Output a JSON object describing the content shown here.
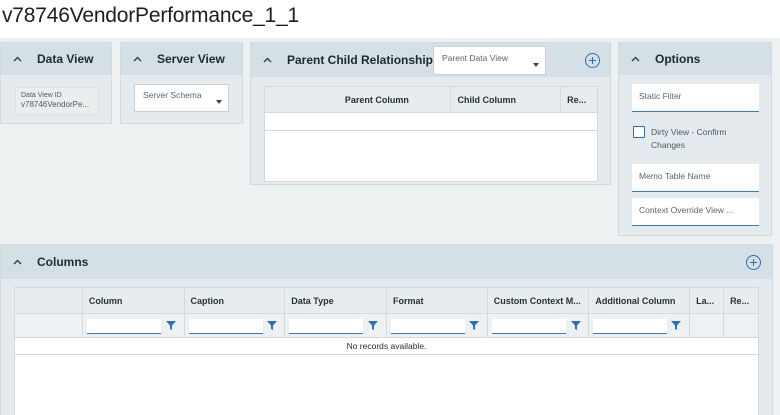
{
  "page": {
    "title": "v78746VendorPerformance_1_1"
  },
  "data_view": {
    "heading": "Data View",
    "field_label": "Data View ID",
    "field_value": "v78746VendorPe..."
  },
  "server_view": {
    "heading": "Server View",
    "schema_placeholder": "Server Schema"
  },
  "relationships": {
    "heading": "Parent Child Relationships",
    "parent_select": "Parent Data View",
    "columns": [
      "",
      "Parent Column",
      "Child Column",
      "Re..."
    ]
  },
  "options": {
    "heading": "Options",
    "static_filter": "Static Filter",
    "dirty_view_label": "Dirty View - Confirm Changes",
    "memo_table": "Memo Table Name",
    "context_override": "Context Override View ..."
  },
  "columns_section": {
    "heading": "Columns",
    "columns": [
      "",
      "Column",
      "Caption",
      "Data Type",
      "Format",
      "Custom Context M...",
      "Additional Column",
      "La...",
      "Re..."
    ],
    "empty_text": "No records available."
  },
  "colors": {
    "accent": "#2f6fb5",
    "header_bg": "#d4e0e5",
    "panel_bg": "#e4eaed"
  }
}
